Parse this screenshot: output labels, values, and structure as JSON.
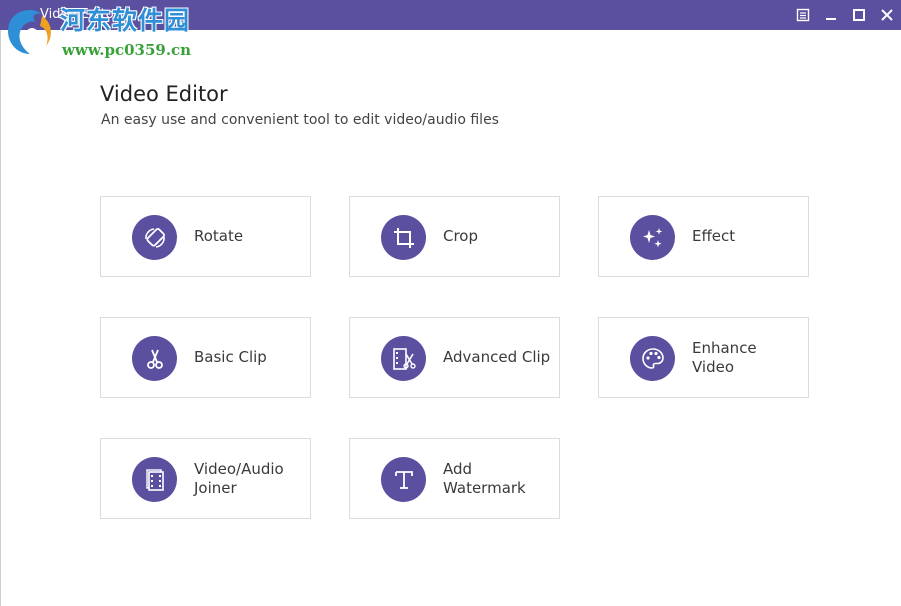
{
  "window": {
    "title": "Video Editor"
  },
  "watermark": {
    "title": "河东软件园",
    "url": "www.pc0359.cn"
  },
  "page": {
    "heading": "Video Editor",
    "subtitle": "An easy use and convenient tool to edit video/audio files"
  },
  "tools": [
    {
      "label": "Rotate",
      "icon": "rotate-icon"
    },
    {
      "label": "Crop",
      "icon": "crop-icon"
    },
    {
      "label": "Effect",
      "icon": "sparkle-icon"
    },
    {
      "label": "Basic Clip",
      "icon": "scissors-icon"
    },
    {
      "label": "Advanced Clip",
      "icon": "film-scissors-icon"
    },
    {
      "label": "Enhance\nVideo",
      "icon": "palette-icon"
    },
    {
      "label": "Video/Audio\nJoiner",
      "icon": "film-stack-icon"
    },
    {
      "label": "Add\nWatermark",
      "icon": "text-icon"
    }
  ],
  "colors": {
    "titlebar": "#5b4fa0",
    "accent": "#5b4fa0",
    "tile_border": "#dcdcdc"
  }
}
